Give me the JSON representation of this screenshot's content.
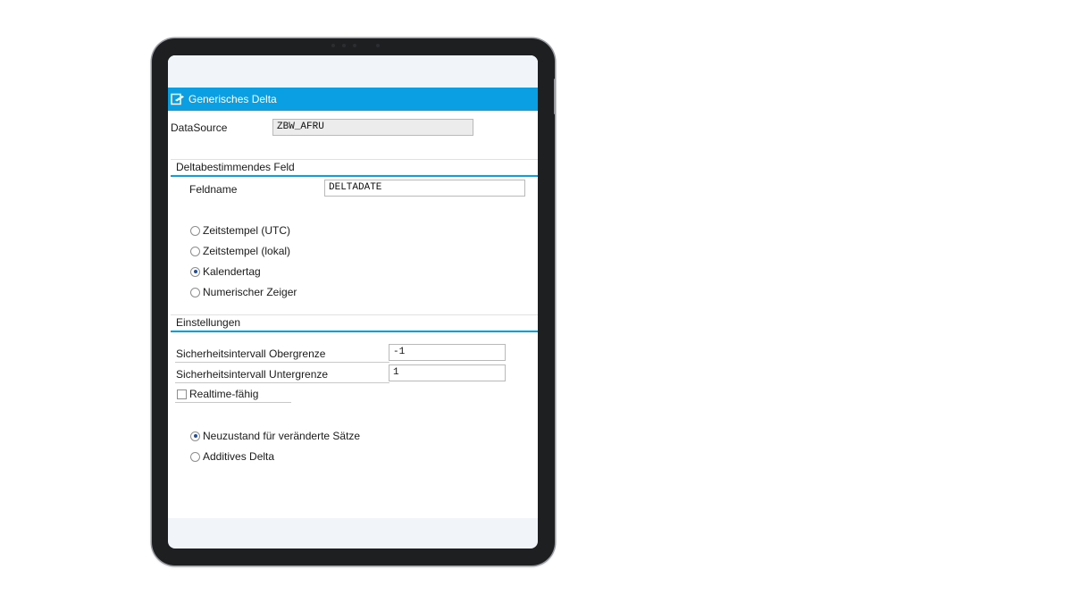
{
  "window": {
    "title": "Generisches Delta",
    "title_icon": "edit-document-icon",
    "accent_color": "#0a9ee3"
  },
  "datasource": {
    "label": "DataSource",
    "value": "ZBW_AFRU"
  },
  "delta_field_group": {
    "title": "Deltabestimmendes Feld",
    "fieldname_label": "Feldname",
    "fieldname_value": "DELTADATE",
    "options": [
      {
        "label": "Zeitstempel (UTC)",
        "selected": false
      },
      {
        "label": "Zeitstempel (lokal)",
        "selected": false
      },
      {
        "label": "Kalendertag",
        "selected": true
      },
      {
        "label": "Numerischer Zeiger",
        "selected": false
      }
    ]
  },
  "settings_group": {
    "title": "Einstellungen",
    "upper_label": "Sicherheitsintervall Obergrenze",
    "upper_value": "-1",
    "lower_label": "Sicherheitsintervall Untergrenze",
    "lower_value": "1",
    "realtime_label": "Realtime-fähig",
    "realtime_checked": false,
    "options": [
      {
        "label": "Neuzustand für veränderte Sätze",
        "selected": true
      },
      {
        "label": "Additives Delta",
        "selected": false
      }
    ]
  }
}
